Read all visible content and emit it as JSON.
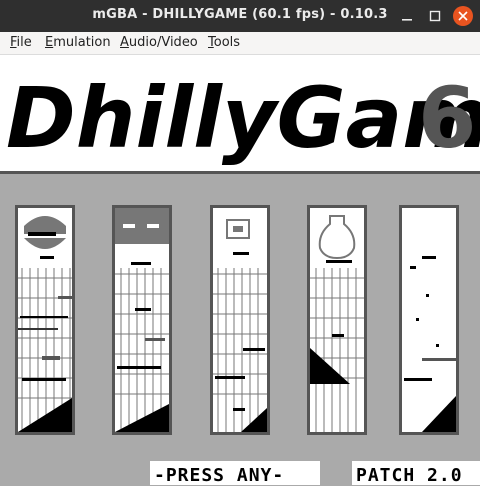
{
  "window": {
    "title": "mGBA - DHILLYGAME (60.1 fps) - 0.10.3"
  },
  "menu": [
    {
      "first": "F",
      "rest": "ile"
    },
    {
      "first": "E",
      "rest": "mulation"
    },
    {
      "first": "A",
      "rest": "udio/Video"
    },
    {
      "first": "T",
      "rest": "ools"
    }
  ],
  "game": {
    "title_text": "DhillyGame",
    "title_number": "6",
    "press_text": "-PRESS ANY-",
    "patch_text": "PATCH 2.0"
  },
  "colors": {
    "titlebar": "#2f2f2f",
    "close_button": "#e95420",
    "screen_bg": "#aaaaaa",
    "card_border": "#555555",
    "number_gray": "#555555"
  }
}
